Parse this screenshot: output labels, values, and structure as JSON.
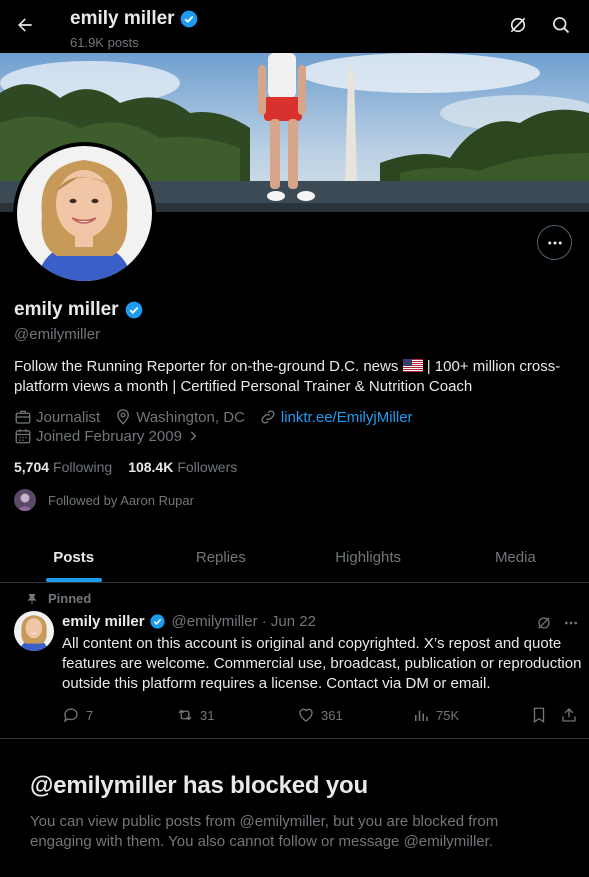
{
  "header": {
    "name": "emily miller",
    "posts_count": "61.9K posts"
  },
  "profile": {
    "name": "emily miller",
    "handle": "@emilymiller",
    "bio_part1": "Follow the Running Reporter for on-the-ground D.C. news",
    "bio_part2": "| 100+ million cross-platform views a month | Certified Personal Trainer & Nutrition Coach",
    "category": "Journalist",
    "location": "Washington, DC",
    "link": "linktr.ee/EmilyjMiller",
    "joined": "Joined February 2009",
    "following_count": "5,704",
    "following_label": "Following",
    "followers_count": "108.4K",
    "followers_label": "Followers",
    "followed_by": "Followed by Aaron Rupar"
  },
  "tabs": [
    {
      "label": "Posts",
      "active": true
    },
    {
      "label": "Replies",
      "active": false
    },
    {
      "label": "Highlights",
      "active": false
    },
    {
      "label": "Media",
      "active": false
    }
  ],
  "pinned_tweet": {
    "pinned_label": "Pinned",
    "name": "emily miller",
    "handle_date": "@emilymiller · Jun 22",
    "text": "All content on this account is original and copyrighted. X’s repost and quote features are welcome. Commercial use, broadcast, publication or reproduction outside this platform requires a license. Contact via DM or email.",
    "replies": "7",
    "reposts": "31",
    "likes": "361",
    "views": "75K"
  },
  "blocked": {
    "title": "@emilymiller has blocked you",
    "message": "You can view public posts from @emilymiller, but you are blocked from engaging with them. You also cannot follow or message @emilymiller."
  },
  "colors": {
    "accent": "#1d9bf0",
    "background": "#000000",
    "text_primary": "#e7e9ea",
    "text_secondary": "#71767b"
  }
}
